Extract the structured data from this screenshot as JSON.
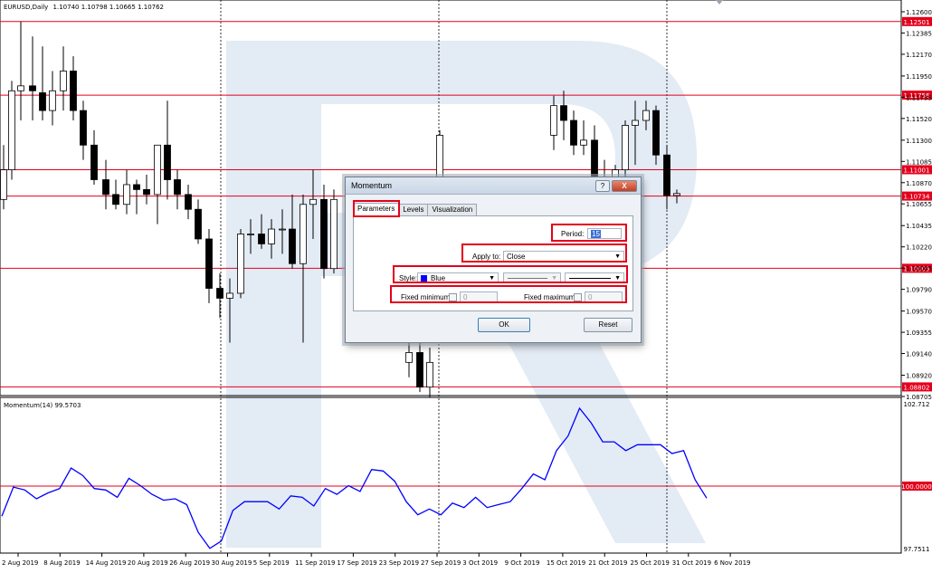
{
  "chart": {
    "symbol_header": "EURUSD,Daily",
    "ohlc": "1.10740 1.10798 1.10665 1.10762",
    "indicator_header": "Momentum(14) 99.5703",
    "price_axis": [
      "1.12600",
      "1.12385",
      "1.12170",
      "1.11950",
      "1.11735",
      "1.11520",
      "1.11300",
      "1.11085",
      "1.10870",
      "1.10655",
      "1.10435",
      "1.10220",
      "1.10005",
      "1.09790",
      "1.09570",
      "1.09355",
      "1.09140",
      "1.08920",
      "1.08705"
    ],
    "red_levels": [
      "1.12501",
      "1.11756",
      "1.11001",
      "1.10734",
      "1.10003",
      "1.08802"
    ],
    "momentum_axis": [
      "102.712",
      "97.7511"
    ],
    "momentum_level": "100.0000",
    "date_labels": [
      "2 Aug 2019",
      "8 Aug 2019",
      "14 Aug 2019",
      "20 Aug 2019",
      "26 Aug 2019",
      "30 Aug 2019",
      "5 Sep 2019",
      "11 Sep 2019",
      "17 Sep 2019",
      "23 Sep 2019",
      "27 Sep 2019",
      "3 Oct 2019",
      "9 Oct 2019",
      "15 Oct 2019",
      "21 Oct 2019",
      "25 Oct 2019",
      "31 Oct 2019",
      "6 Nov 2019"
    ],
    "colors": {
      "level": "#e3001b",
      "momentum": "#0000ff",
      "watermark": "#dfe8f3",
      "candle": "#000000"
    }
  },
  "dialog": {
    "title": "Momentum",
    "help_label": "?",
    "close_label": "X",
    "tabs": [
      "Parameters",
      "Levels",
      "Visualization"
    ],
    "period_label": "Period:",
    "period_value": "15",
    "apply_to_label": "Apply to:",
    "apply_to_value": "Close",
    "style_label": "Style:",
    "style_color_name": "Blue",
    "style_color": "#0000ff",
    "fixed_min_label": "Fixed minimum",
    "fixed_min_value": "0",
    "fixed_max_label": "Fixed maximum",
    "fixed_max_value": "0",
    "ok_label": "OK",
    "reset_label": "Reset"
  }
}
